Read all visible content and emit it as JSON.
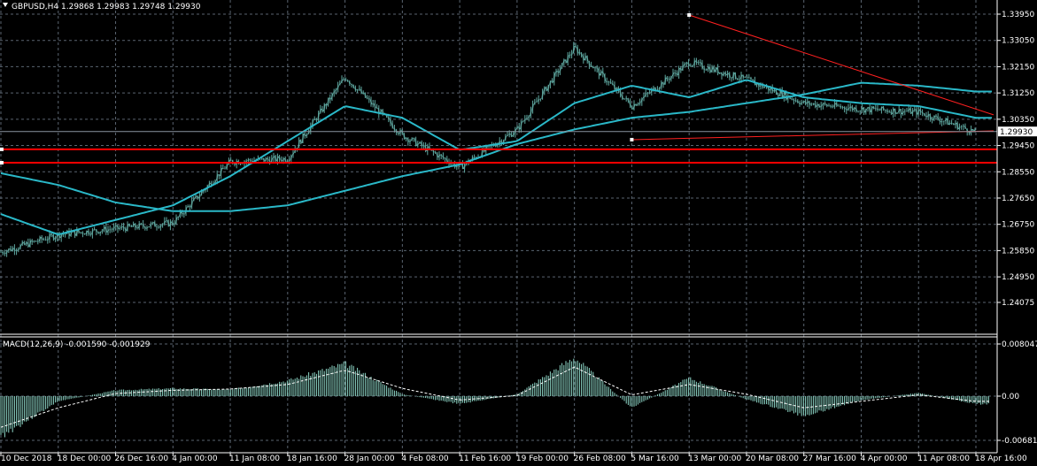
{
  "header": {
    "symbol_line": "GBPUSD,H4  1.29868 1.29983 1.29748 1.29930"
  },
  "macd": {
    "label": "MACD(12,26,9) -0.001590 -0.001929"
  },
  "price_badge": "1.29930",
  "colors": {
    "background": "#000000",
    "grid": "#5a6470",
    "candles": "#5fa8a0",
    "moving_average": "#2ab8c8",
    "trendline": "#ff2020",
    "horizontal_levels": "#ff0000",
    "macd_histogram": "#8fd8c8",
    "macd_signal": "#ffffff",
    "text": "#ffffff"
  },
  "chart_data": [
    {
      "type": "line",
      "title": "GBPUSD,H4",
      "x_ticks": [
        "10 Dec 2018",
        "18 Dec 00:00",
        "26 Dec 16:00",
        "4 Jan 00:00",
        "11 Jan 08:00",
        "18 Jan 16:00",
        "28 Jan 00:00",
        "4 Feb 08:00",
        "11 Feb 16:00",
        "19 Feb 00:00",
        "26 Feb 08:00",
        "5 Mar 16:00",
        "13 Mar 00:00",
        "20 Mar 08:00",
        "27 Mar 16:00",
        "4 Apr 00:00",
        "11 Apr 08:00",
        "18 Apr 16:00"
      ],
      "y_ticks": [
        "1.33950",
        "1.33050",
        "1.32150",
        "1.31250",
        "1.30350",
        "1.29450",
        "1.28550",
        "1.27650",
        "1.26750",
        "1.25850",
        "1.24950",
        "1.24075"
      ],
      "ylim": [
        1.24075,
        1.3395
      ],
      "current_price": 1.2993,
      "horizontal_levels": [
        1.2932,
        1.2886
      ],
      "series": [
        {
          "name": "",
          "x": [
            "10 Dec 2018",
            "18 Dec 00:00",
            "26 Dec 16:00",
            "4 Jan 00:00",
            "11 Jan 08:00",
            "18 Jan 16:00",
            "28 Jan 00:00",
            "4 Feb 08:00",
            "11 Feb 16:00",
            "19 Feb 00:00",
            "26 Feb 08:00",
            "5 Mar 16:00",
            "13 Mar 00:00",
            "20 Mar 08:00",
            "27 Mar 16:00",
            "4 Apr 00:00",
            "11 Apr 08:00",
            "18 Apr 16:00"
          ],
          "values": [
            1.258,
            1.264,
            1.266,
            1.268,
            1.289,
            1.29,
            1.318,
            1.298,
            1.287,
            1.3,
            1.328,
            1.308,
            1.323,
            1.317,
            1.309,
            1.307,
            1.306,
            1.299
          ]
        },
        {
          "name": "",
          "x": [
            "10 Dec 2018",
            "18 Dec 00:00",
            "26 Dec 16:00",
            "4 Jan 00:00",
            "11 Jan 08:00",
            "18 Jan 16:00",
            "28 Jan 00:00",
            "4 Feb 08:00",
            "11 Feb 16:00",
            "19 Feb 00:00",
            "26 Feb 08:00",
            "5 Mar 16:00",
            "13 Mar 00:00",
            "20 Mar 08:00",
            "27 Mar 16:00",
            "4 Apr 00:00",
            "11 Apr 08:00",
            "18 Apr 16:00"
          ],
          "values": [
            1.271,
            1.264,
            1.269,
            1.274,
            1.284,
            1.296,
            1.308,
            1.304,
            1.293,
            1.296,
            1.309,
            1.315,
            1.311,
            1.317,
            1.311,
            1.309,
            1.308,
            1.304
          ]
        },
        {
          "name": "",
          "x": [
            "10 Dec 2018",
            "18 Dec 00:00",
            "26 Dec 16:00",
            "4 Jan 00:00",
            "11 Jan 08:00",
            "18 Jan 16:00",
            "28 Jan 00:00",
            "4 Feb 08:00",
            "11 Feb 16:00",
            "19 Feb 00:00",
            "26 Feb 08:00",
            "5 Mar 16:00",
            "13 Mar 00:00",
            "20 Mar 08:00",
            "27 Mar 16:00",
            "4 Apr 00:00",
            "11 Apr 08:00",
            "18 Apr 16:00"
          ],
          "values": [
            1.285,
            1.281,
            1.275,
            1.272,
            1.272,
            1.274,
            1.279,
            1.284,
            1.288,
            1.295,
            1.3,
            1.304,
            1.306,
            1.309,
            1.312,
            1.316,
            1.315,
            1.313
          ]
        }
      ],
      "trendlines": [
        {
          "from": [
            "13 Mar 00:00",
            1.3392
          ],
          "to": [
            "18 Apr 16:00",
            1.305
          ]
        },
        {
          "from": [
            "5 Mar 16:00",
            1.2965
          ],
          "to": [
            "18 Apr 16:00",
            1.2995
          ]
        }
      ]
    },
    {
      "type": "bar",
      "title": "MACD(12,26,9) -0.001590 -0.001929",
      "y_ticks": [
        "0.008047",
        "0.00",
        "-0.006819"
      ],
      "ylim": [
        -0.006819,
        0.008047
      ],
      "series": [
        {
          "name": "",
          "x": [
            "10 Dec 2018",
            "18 Dec 00:00",
            "26 Dec 16:00",
            "4 Jan 00:00",
            "11 Jan 08:00",
            "18 Jan 16:00",
            "28 Jan 00:00",
            "4 Feb 08:00",
            "11 Feb 16:00",
            "19 Feb 00:00",
            "26 Feb 08:00",
            "5 Mar 16:00",
            "13 Mar 00:00",
            "20 Mar 08:00",
            "27 Mar 16:00",
            "4 Apr 00:00",
            "11 Apr 08:00",
            "18 Apr 16:00"
          ],
          "values": [
            -0.0062,
            -0.0008,
            0.0009,
            0.0012,
            0.001,
            0.0024,
            0.005,
            0.0003,
            -0.0012,
            0.0003,
            0.006,
            -0.0018,
            0.0028,
            -0.0005,
            -0.003,
            -0.0006,
            0.0005,
            -0.0012
          ]
        },
        {
          "name": "",
          "x": [
            "10 Dec 2018",
            "18 Dec 00:00",
            "26 Dec 16:00",
            "4 Jan 00:00",
            "11 Jan 08:00",
            "18 Jan 16:00",
            "28 Jan 00:00",
            "4 Feb 08:00",
            "11 Feb 16:00",
            "19 Feb 00:00",
            "26 Feb 08:00",
            "5 Mar 16:00",
            "13 Mar 00:00",
            "20 Mar 08:00",
            "27 Mar 16:00",
            "4 Apr 00:00",
            "11 Apr 08:00",
            "18 Apr 16:00"
          ],
          "values": [
            -0.0048,
            -0.0018,
            0.0004,
            0.0009,
            0.0011,
            0.0018,
            0.004,
            0.0012,
            -0.0006,
            0.0001,
            0.0045,
            0.0002,
            0.0018,
            0.0003,
            -0.0018,
            -0.0008,
            0.0002,
            -0.0008
          ]
        }
      ]
    }
  ]
}
